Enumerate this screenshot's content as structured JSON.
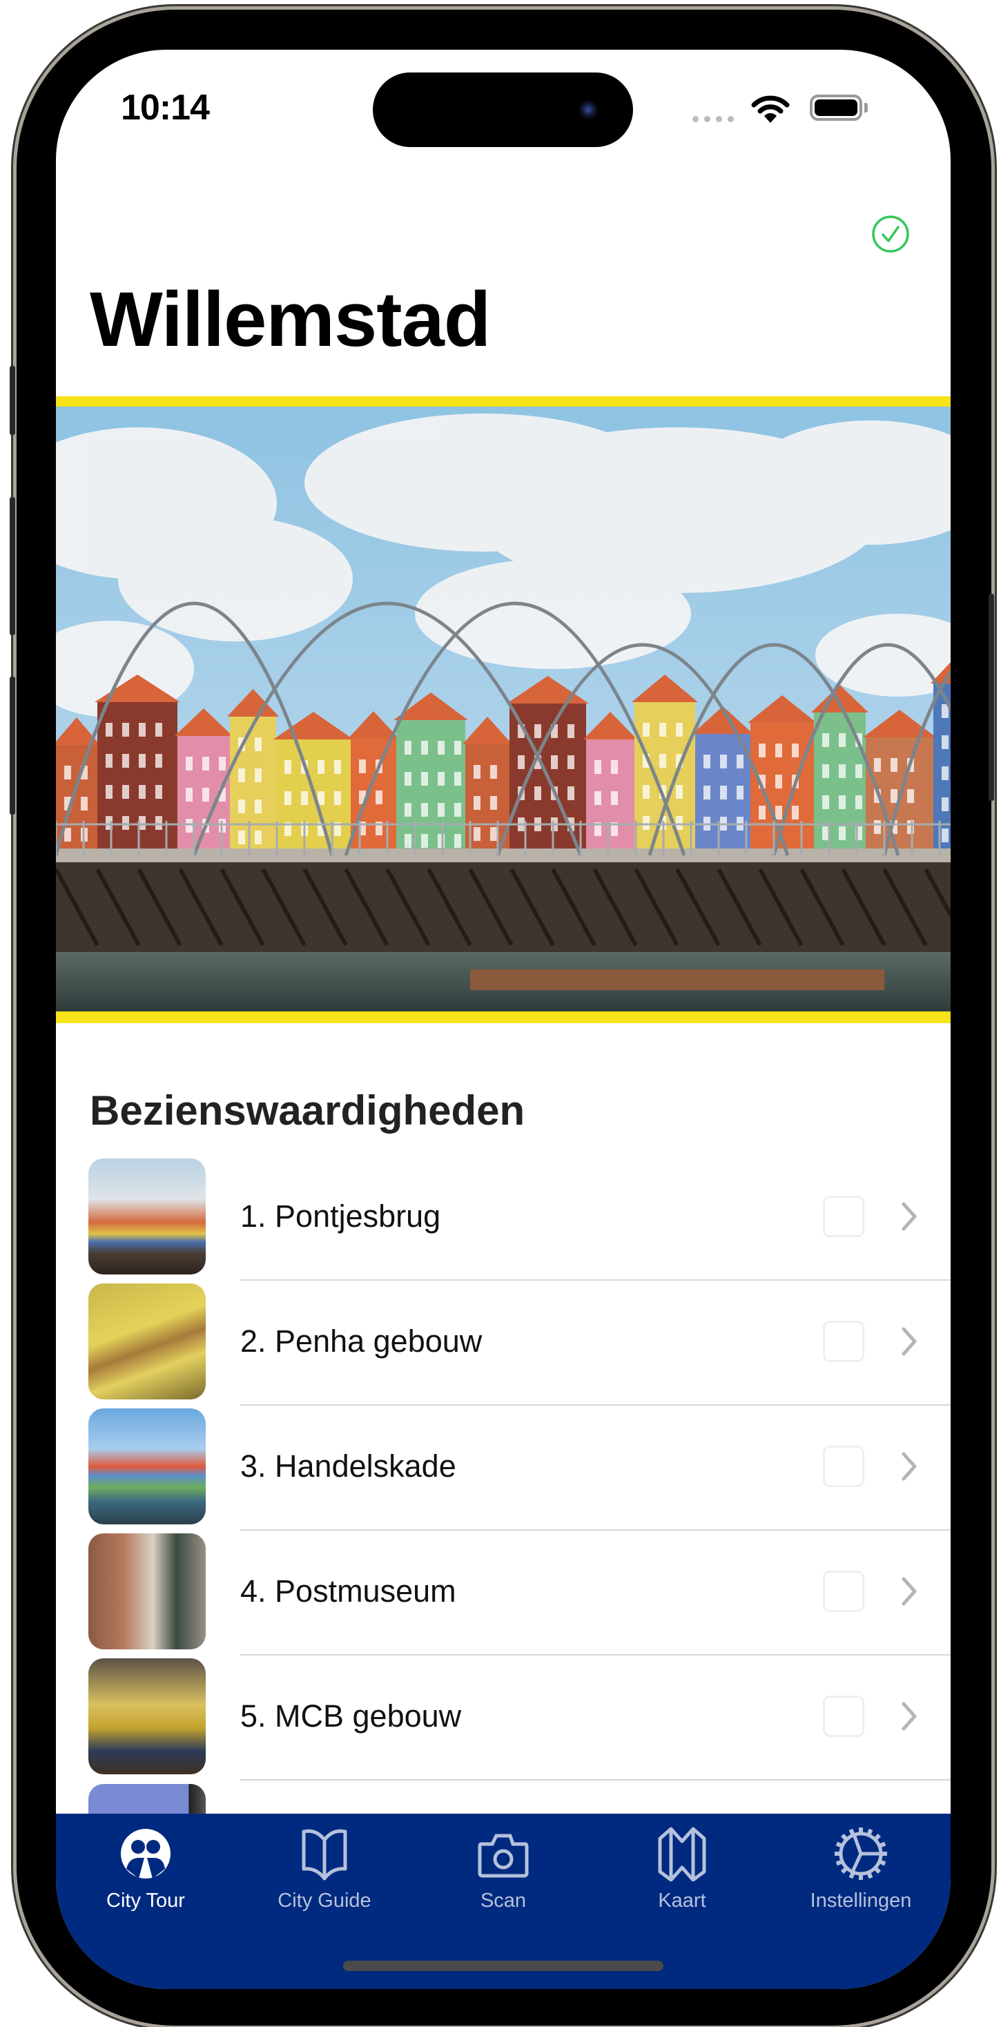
{
  "status_bar": {
    "time": "10:14"
  },
  "header": {
    "title": "Willemstad",
    "status_icon": "checkmark-circle-icon"
  },
  "section": {
    "title": "Bezienswaardigheden"
  },
  "sights": [
    {
      "label": "1. Pontjesbrug",
      "checked": false
    },
    {
      "label": "2. Penha gebouw",
      "checked": false
    },
    {
      "label": "3. Handelskade",
      "checked": false
    },
    {
      "label": "4. Postmuseum",
      "checked": false
    },
    {
      "label": "5. MCB gebouw",
      "checked": false
    }
  ],
  "tabs": [
    {
      "label": "City Tour",
      "icon": "people-circle-icon",
      "active": true
    },
    {
      "label": "City Guide",
      "icon": "book-icon",
      "active": false
    },
    {
      "label": "Scan",
      "icon": "camera-icon",
      "active": false
    },
    {
      "label": "Kaart",
      "icon": "map-icon",
      "active": false
    },
    {
      "label": "Instellingen",
      "icon": "gear-icon",
      "active": false
    }
  ],
  "colors": {
    "accent_yellow": "#f8e21a",
    "tabbar": "#002a7f",
    "check_green": "#34c759"
  }
}
